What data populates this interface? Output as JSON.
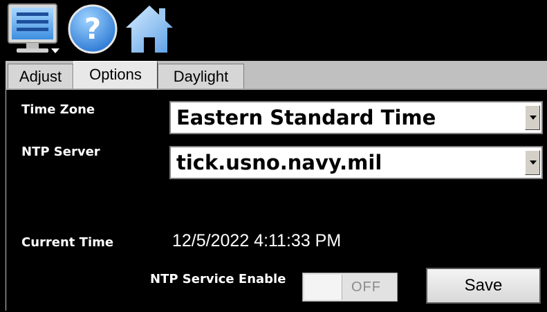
{
  "toolbar": {
    "icons": [
      "monitor-menu-icon",
      "help-icon",
      "home-icon"
    ]
  },
  "tabs": [
    {
      "label": "Adjust"
    },
    {
      "label": "Options",
      "active": true
    },
    {
      "label": "Daylight"
    }
  ],
  "form": {
    "time_zone_label": "Time Zone",
    "time_zone_value": "Eastern Standard Time",
    "ntp_server_label": "NTP Server",
    "ntp_server_value": "tick.usno.navy.mil",
    "current_time_label": "Current Time",
    "current_time_value": "12/5/2022 4:11:33 PM",
    "ntp_service_label": "NTP Service Enable",
    "ntp_service_state": "OFF",
    "save_label": "Save"
  },
  "colors": {
    "background": "#000000",
    "tab_bar": "#c0c0c0",
    "text": "#ffffff",
    "icon_blue": "#2f7fd6"
  }
}
